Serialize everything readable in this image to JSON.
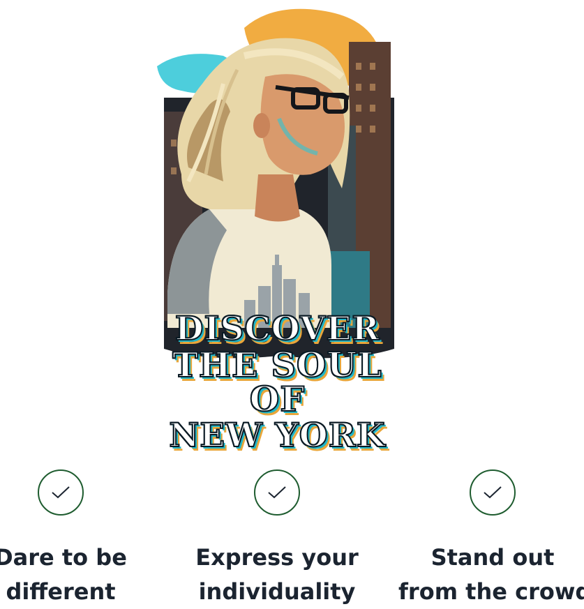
{
  "artwork": {
    "slogan_lines": [
      "DISCOVER",
      "THE SOUL OF",
      "NEW YORK"
    ],
    "accent_colors": {
      "orange": "#f0a32c",
      "cyan": "#2ec6d6",
      "dark": "#1a1d22",
      "hair": "#e8d7a8",
      "skin": "#d99a6c",
      "shirt_gray": "#8d9597",
      "shirt_cream": "#f1ead3"
    }
  },
  "features": [
    {
      "icon": "check-icon",
      "lines": [
        "Dare to be",
        "different"
      ]
    },
    {
      "icon": "check-icon",
      "lines": [
        "Express your",
        "individuality"
      ]
    },
    {
      "icon": "check-icon",
      "lines": [
        "Stand out",
        "from the crowd"
      ]
    }
  ],
  "colors": {
    "check_stroke": "#1e5c2f",
    "text": "#1b2430"
  }
}
